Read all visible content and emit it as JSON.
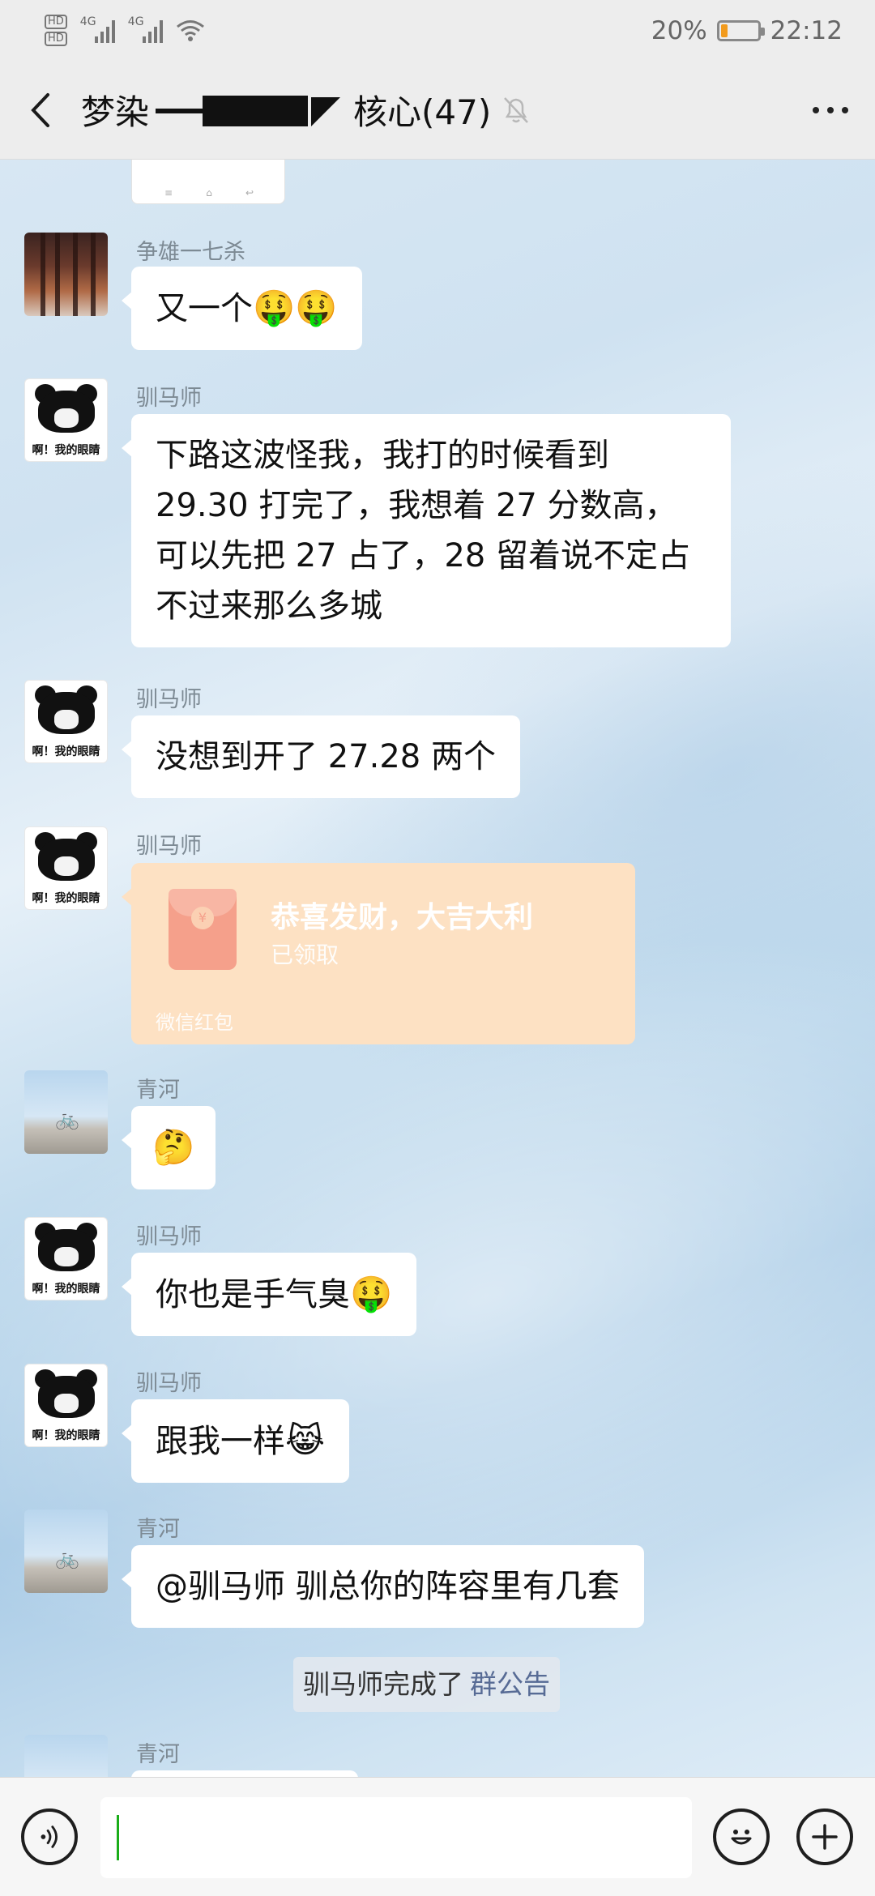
{
  "status_bar": {
    "hd1": "HD",
    "hd2": "HD",
    "net1": "4G",
    "net2": "4G",
    "battery_text": "20%",
    "battery_level": 0.2,
    "time": "22:12"
  },
  "header": {
    "title_prefix": "梦染",
    "title_suffix": "核心(47)",
    "icons": {
      "back": "chevron-left-icon",
      "mute": "bell-off-icon",
      "more": "more-dots-icon"
    }
  },
  "messages": [
    {
      "sender": "争雄一七杀",
      "avatar": "forest-avatar",
      "text": "又一个",
      "emoji": "🤑🤑"
    },
    {
      "sender": "驯马师",
      "avatar": "panda-avatar",
      "avatar_caption": "啊！我的眼睛",
      "lines": [
        "下路这波怪我，我打的时候看到",
        "29.30 打完了，我想着 27 分数高，",
        "可以先把 27 占了，28 留着说不定占",
        "不过来那么多城"
      ]
    },
    {
      "sender": "驯马师",
      "avatar": "panda-avatar",
      "avatar_caption": "啊！我的眼睛",
      "text": "没想到开了 27.28 两个"
    },
    {
      "sender": "驯马师",
      "avatar": "panda-avatar",
      "avatar_caption": "啊！我的眼睛",
      "hongbao": {
        "title": "恭喜发财，大吉大利",
        "status": "已领取",
        "footer": "微信红包",
        "coin": "¥"
      }
    },
    {
      "sender": "青河",
      "avatar": "bike-avatar",
      "emoji": "🤔"
    },
    {
      "sender": "驯马师",
      "avatar": "panda-avatar",
      "avatar_caption": "啊！我的眼睛",
      "text": "你也是手气臭",
      "emoji": "🤑"
    },
    {
      "sender": "驯马师",
      "avatar": "panda-avatar",
      "avatar_caption": "啊！我的眼睛",
      "text": "跟我一样",
      "emoji": "😹"
    },
    {
      "sender": "青河",
      "avatar": "bike-avatar",
      "text": "@驯马师  驯总你的阵容里有几套"
    },
    {
      "sender": "青河",
      "avatar": "bike-avatar"
    }
  ],
  "system_notice": {
    "text": "驯马师完成了",
    "link": "群公告"
  },
  "prev_card": {
    "icons": [
      "≡",
      "⌂",
      "↩"
    ]
  },
  "input_bar": {
    "icons": {
      "voice": "voice-icon",
      "emoji": "emoji-icon",
      "plus": "plus-icon"
    }
  }
}
